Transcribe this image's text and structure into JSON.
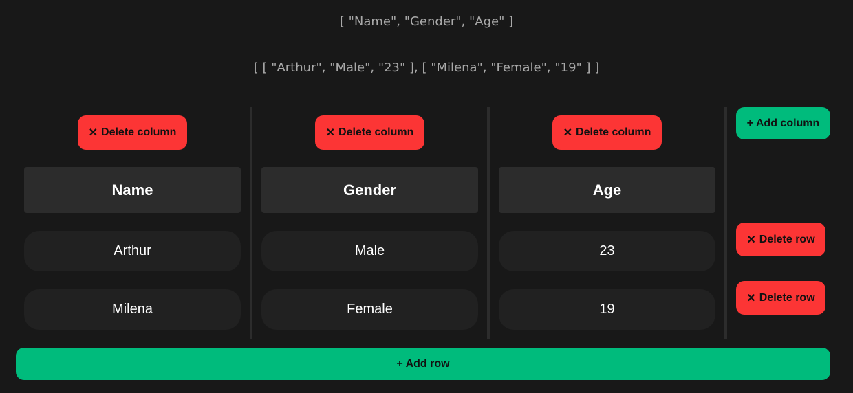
{
  "header_json": "[ \"Name\", \"Gender\", \"Age\" ]",
  "rows_json": "[ [ \"Arthur\", \"Male\", \"23\" ], [ \"Milena\", \"Female\", \"19\" ] ]",
  "buttons": {
    "delete_column": "Delete column",
    "add_column": "+ Add column",
    "delete_row": "Delete row",
    "add_row": "+ Add row",
    "delete_icon": "close-icon"
  },
  "columns": [
    {
      "header": "Name"
    },
    {
      "header": "Gender"
    },
    {
      "header": "Age"
    }
  ],
  "rows": [
    [
      "Arthur",
      "Male",
      "23"
    ],
    [
      "Milena",
      "Female",
      "19"
    ]
  ],
  "colors": {
    "background": "#181818",
    "danger": "#fc3535",
    "success": "#00bb7c",
    "header_bg": "#2c2c2c",
    "cell_bg": "#212121"
  }
}
